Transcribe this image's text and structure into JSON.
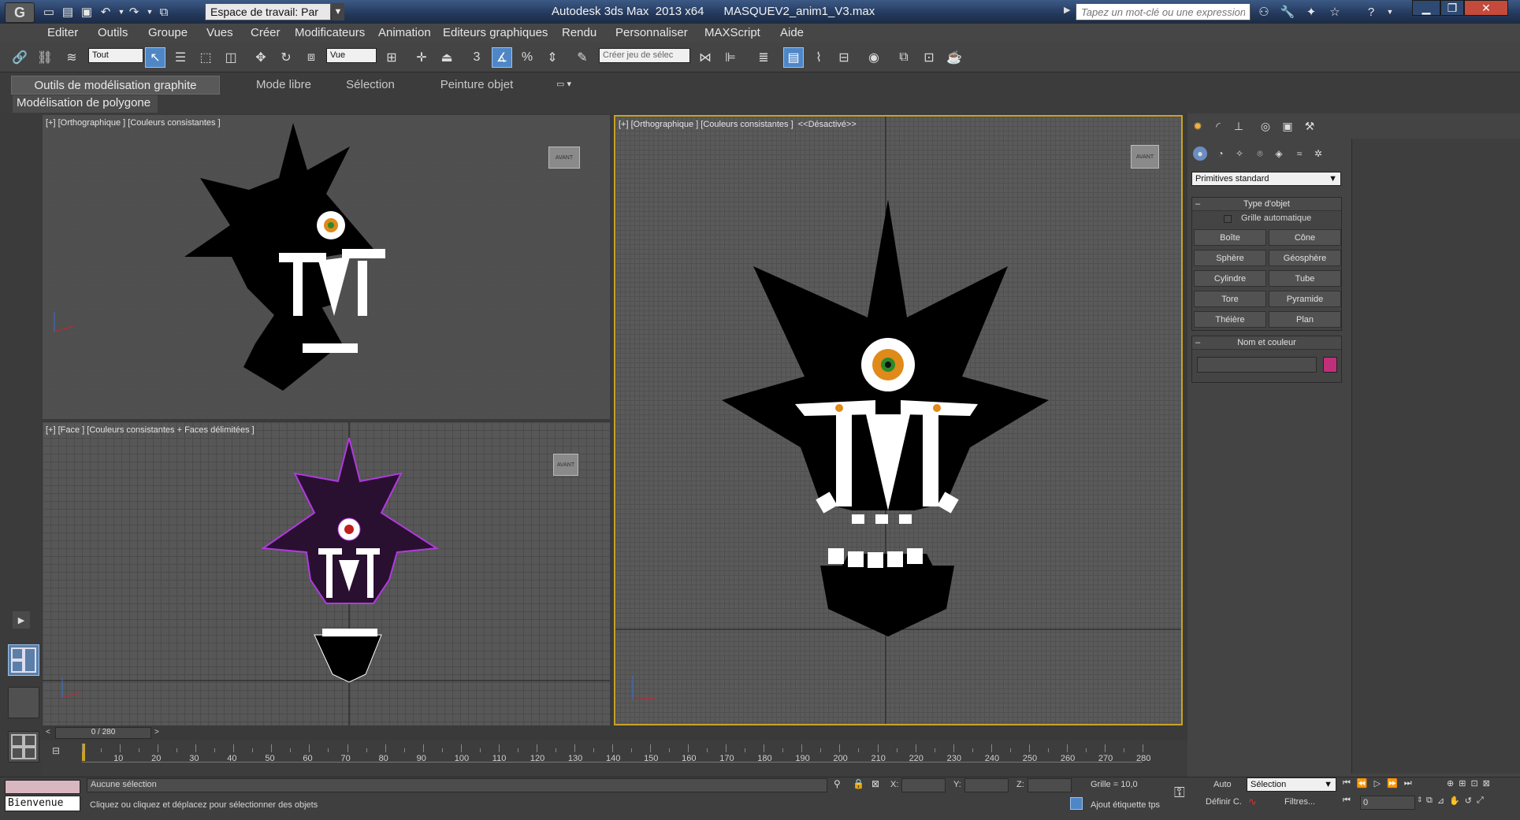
{
  "titlebar": {
    "workspace_label": "Espace de travail: Par",
    "title": "Autodesk 3ds Max  2013 x64      MASQUEV2_anim1_V3.max",
    "search_placeholder": "Tapez un mot-clé ou une expression"
  },
  "menu": [
    "Editer",
    "Outils",
    "Groupe",
    "Vues",
    "Créer",
    "Modificateurs",
    "Animation",
    "Editeurs graphiques",
    "Rendu",
    "Personnaliser",
    "MAXScript",
    "Aide"
  ],
  "toolbar": {
    "filter_value": "Tout",
    "coord_value": "Vue",
    "selection_set_placeholder": "Créer jeu de sélec"
  },
  "ribbon": {
    "tabs": [
      "Outils de modélisation graphite",
      "Mode libre",
      "Sélection",
      "Peinture objet"
    ],
    "panel_label": "Modélisation de polygone"
  },
  "viewports": {
    "top_left": "[+] [Orthographique ] [Couleurs consistantes ]",
    "bottom_left": "[+] [Face ] [Couleurs consistantes + Faces délimitées ]",
    "right": "[+] [Orthographique ] [Couleurs consistantes ]  <<Désactivé>>",
    "viewcube_label": "AVANT"
  },
  "command_panel": {
    "category_value": "Primitives standard",
    "object_type_title": "Type d'objet",
    "autogrid_label": "Grille automatique",
    "object_buttons": [
      "Boîte",
      "Cône",
      "Sphère",
      "Géosphère",
      "Cylindre",
      "Tube",
      "Tore",
      "Pyramide",
      "Théière",
      "Plan"
    ],
    "name_color_title": "Nom et couleur",
    "color_swatch": "#c0307a"
  },
  "timeline": {
    "frame_counter": "0 / 280",
    "ticks": [
      "10",
      "20",
      "30",
      "40",
      "50",
      "60",
      "70",
      "80",
      "90",
      "100",
      "110",
      "120",
      "130",
      "140",
      "150",
      "160",
      "170",
      "180",
      "190",
      "200",
      "210",
      "220",
      "230",
      "240",
      "250",
      "260",
      "270",
      "280"
    ],
    "current_frame": 0,
    "total_frames": 280
  },
  "status": {
    "welcome": "Bienvenue",
    "selection_status": "Aucune sélection",
    "prompt": "Cliquez ou cliquez et déplacez pour sélectionner des objets",
    "x_label": "X:",
    "y_label": "Y:",
    "z_label": "Z:",
    "grid_label": "Grille = 10,0",
    "add_time_tag": "Ajout étiquette tps",
    "auto_label": "Auto",
    "key_mode_value": "Sélection",
    "set_key_label": "Définir C.",
    "filters_label": "Filtres...",
    "frame_input": "0"
  },
  "colors": {
    "accent": "#4f86c6",
    "active_viewport_border": "#c9a227",
    "wire_selection": "#b03adf"
  }
}
